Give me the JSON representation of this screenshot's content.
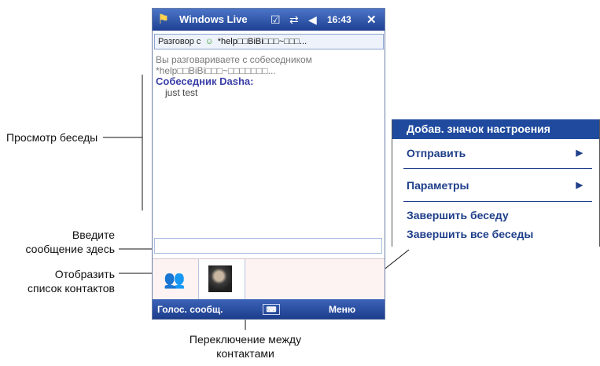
{
  "labels": {
    "conversation_view": "Просмотр беседы",
    "enter_message_line1": "Введите",
    "enter_message_line2": "сообщение здесь",
    "show_contacts_line1": "Отобразить",
    "show_contacts_line2": "список контактов",
    "switch_contacts_line1": "Переключение между",
    "switch_contacts_line2": "контактами"
  },
  "phone": {
    "title": "Windows Live",
    "time": "16:43",
    "chat_header": "Разговор с",
    "chat_header_contact": "*help□□BiBi□□□~□□□...",
    "conversation": {
      "system_line1": "Вы разговариваете с собеседником",
      "system_line2": "*help□□BiBi□□□~□□□□□□□...",
      "sender": "Собеседник Dasha:",
      "message": "just test"
    },
    "softkey_left": "Голос. сообщ.",
    "softkey_right": "Меню",
    "keyboard_label": "⌨"
  },
  "menu": {
    "items": [
      {
        "label": "Добав. значок настроения"
      },
      {
        "label": "Отправить",
        "submenu": true
      },
      {
        "label": "Параметры",
        "submenu": true
      },
      {
        "label": "Завершить беседу"
      },
      {
        "label": "Завершить все беседы"
      }
    ]
  },
  "colors": {
    "titlebar": "#2b52a8",
    "menu_highlight": "#1f4a9e",
    "menu_text": "#1f3f8a",
    "contact_name": "#3a3fa8"
  }
}
